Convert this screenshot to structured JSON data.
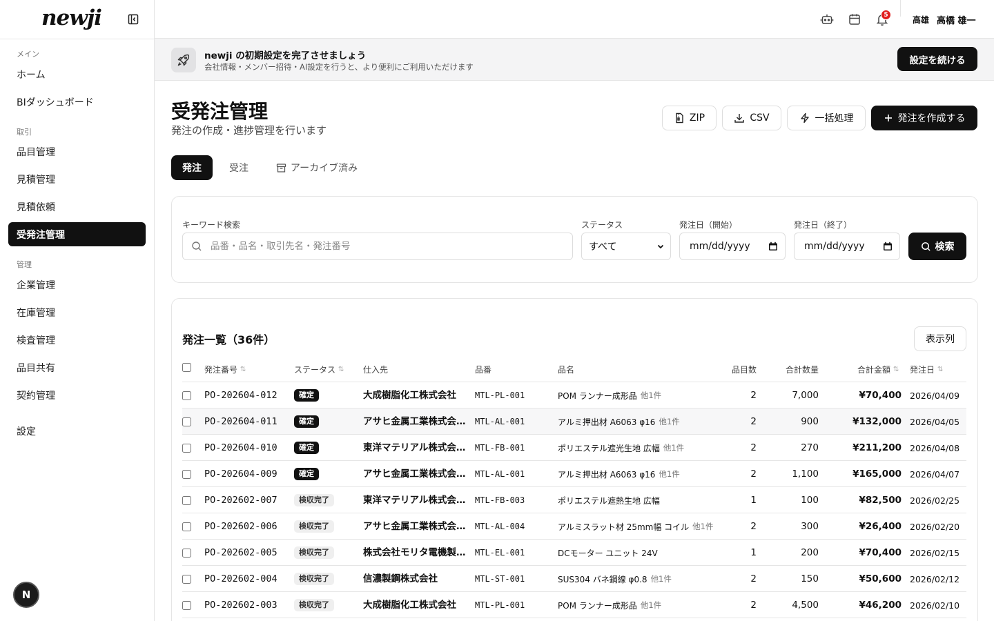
{
  "app": {
    "logo": "newji"
  },
  "sidebar": {
    "sections": [
      "メイン",
      "取引",
      "管理"
    ],
    "items": [
      {
        "label": "ホーム"
      },
      {
        "label": "BIダッシュボード"
      },
      {
        "label": "品目管理"
      },
      {
        "label": "見積管理"
      },
      {
        "label": "見積依頼"
      },
      {
        "label": "受発注管理"
      },
      {
        "label": "企業管理"
      },
      {
        "label": "在庫管理"
      },
      {
        "label": "検査管理"
      },
      {
        "label": "品目共有"
      },
      {
        "label": "契約管理"
      },
      {
        "label": "設定"
      }
    ],
    "active_index": 5,
    "bottom_badge": "N"
  },
  "header": {
    "notification_count": "5",
    "user_company": "高雄",
    "user_name": "高橋 雄一"
  },
  "banner": {
    "title": "newji の初期設定を完了させましょう",
    "subtitle": "会社情報・メンバー招待・AI設定を行うと、より便利にご利用いただけます",
    "button": "設定を続ける"
  },
  "page": {
    "title": "受発注管理",
    "subtitle": "発注の作成・進捗管理を行います",
    "actions": {
      "zip": "ZIP",
      "csv": "CSV",
      "bulk": "一括処理",
      "create": "発注を作成する"
    }
  },
  "tabs": [
    {
      "label": "発注",
      "active": true
    },
    {
      "label": "受注",
      "active": false
    },
    {
      "label": "アーカイブ済み",
      "active": false
    }
  ],
  "filters": {
    "keyword_label": "キーワード検索",
    "keyword_placeholder": "品番・品名・取引先名・発注番号",
    "status_label": "ステータス",
    "status_value": "すべて",
    "date_start_label": "発注日（開始）",
    "date_end_label": "発注日（終了）",
    "date_placeholder": "mm/dd/yyyy",
    "search_button": "検索"
  },
  "table": {
    "title": "発注一覧（36件）",
    "columns_button": "表示列",
    "headers": {
      "po": "発注番号",
      "status": "ステータス",
      "supplier": "仕入先",
      "part_no": "品番",
      "part_name": "品名",
      "item_count": "品目数",
      "total_qty": "合計数量",
      "total_amount": "合計金額",
      "order_date": "発注日"
    },
    "rows": [
      {
        "po": "PO-202604-012",
        "status": "確定",
        "status_style": "dark",
        "supplier": "大成樹脂化工株式会社",
        "part_no": "MTL-PL-001",
        "part_name": "POM ランナー成形品",
        "more": "他1件",
        "items": "2",
        "qty": "7,000",
        "amount": "¥70,400",
        "date": "2026/04/09"
      },
      {
        "po": "PO-202604-011",
        "status": "確定",
        "status_style": "dark",
        "supplier": "アサヒ金属工業株式会…",
        "part_no": "MTL-AL-001",
        "part_name": "アルミ押出材 A6063 φ16",
        "more": "他1件",
        "items": "2",
        "qty": "900",
        "amount": "¥132,000",
        "date": "2026/04/05"
      },
      {
        "po": "PO-202604-010",
        "status": "確定",
        "status_style": "dark",
        "supplier": "東洋マテリアル株式会…",
        "part_no": "MTL-FB-001",
        "part_name": "ポリエステル遮光生地 広幅",
        "more": "他1件",
        "items": "2",
        "qty": "270",
        "amount": "¥211,200",
        "date": "2026/04/08"
      },
      {
        "po": "PO-202604-009",
        "status": "確定",
        "status_style": "dark",
        "supplier": "アサヒ金属工業株式会…",
        "part_no": "MTL-AL-001",
        "part_name": "アルミ押出材 A6063 φ16",
        "more": "他1件",
        "items": "2",
        "qty": "1,100",
        "amount": "¥165,000",
        "date": "2026/04/07"
      },
      {
        "po": "PO-202602-007",
        "status": "検収完了",
        "status_style": "light",
        "supplier": "東洋マテリアル株式会…",
        "part_no": "MTL-FB-003",
        "part_name": "ポリエステル遮熱生地 広幅",
        "more": "",
        "items": "1",
        "qty": "100",
        "amount": "¥82,500",
        "date": "2026/02/25"
      },
      {
        "po": "PO-202602-006",
        "status": "検収完了",
        "status_style": "light",
        "supplier": "アサヒ金属工業株式会…",
        "part_no": "MTL-AL-004",
        "part_name": "アルミスラット材 25mm幅 コイル",
        "more": "他1件",
        "items": "2",
        "qty": "300",
        "amount": "¥26,400",
        "date": "2026/02/20"
      },
      {
        "po": "PO-202602-005",
        "status": "検収完了",
        "status_style": "light",
        "supplier": "株式会社モリタ電機製…",
        "part_no": "MTL-EL-001",
        "part_name": "DCモーター ユニット 24V",
        "more": "",
        "items": "1",
        "qty": "200",
        "amount": "¥70,400",
        "date": "2026/02/15"
      },
      {
        "po": "PO-202602-004",
        "status": "検収完了",
        "status_style": "light",
        "supplier": "信濃製鋼株式会社",
        "part_no": "MTL-ST-001",
        "part_name": "SUS304 バネ鋼線 φ0.8",
        "more": "他1件",
        "items": "2",
        "qty": "150",
        "amount": "¥50,600",
        "date": "2026/02/12"
      },
      {
        "po": "PO-202602-003",
        "status": "検収完了",
        "status_style": "light",
        "supplier": "大成樹脂化工株式会社",
        "part_no": "MTL-PL-001",
        "part_name": "POM ランナー成形品",
        "more": "他1件",
        "items": "2",
        "qty": "4,500",
        "amount": "¥46,200",
        "date": "2026/02/10"
      }
    ]
  }
}
